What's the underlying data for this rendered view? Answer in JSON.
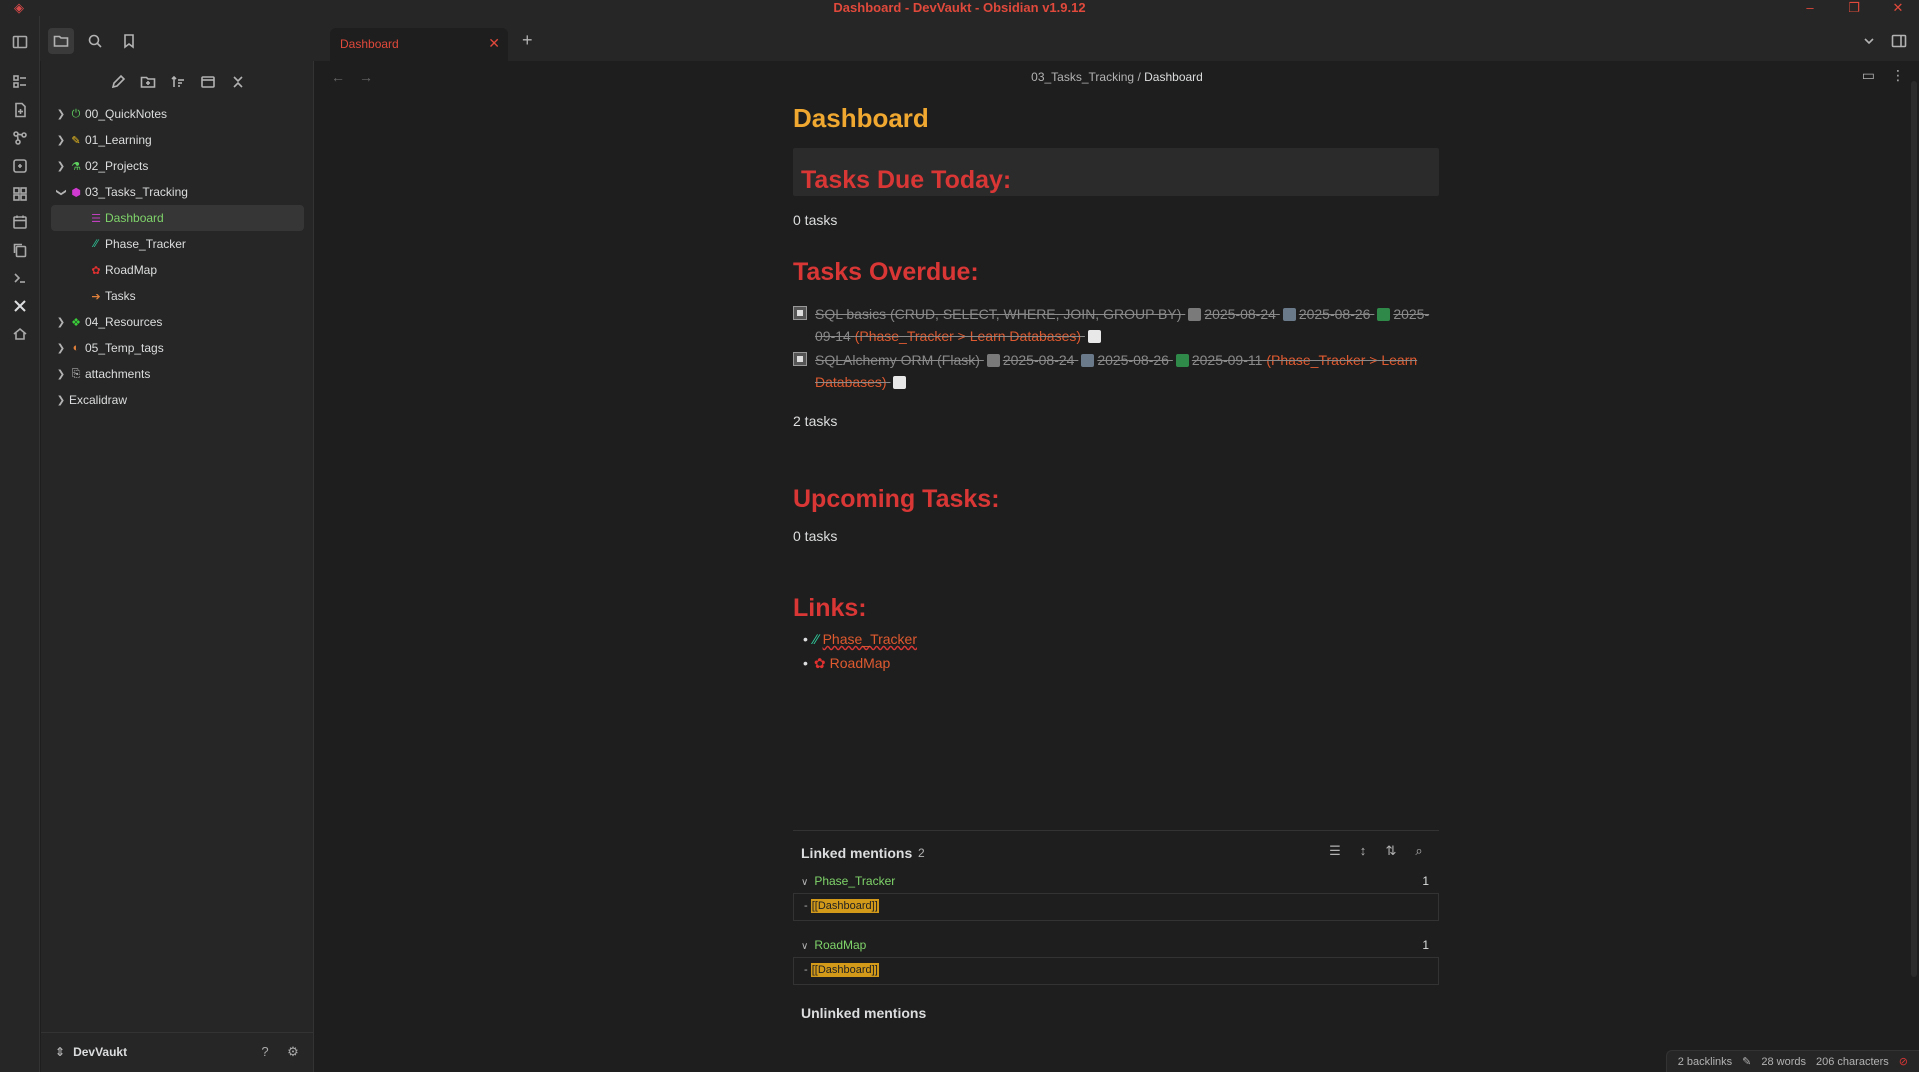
{
  "window": {
    "title": "Dashboard - DevVaukt - Obsidian v1.9.12",
    "controls": [
      "–",
      "❐",
      "✕"
    ]
  },
  "tab": {
    "title": "Dashboard",
    "close": "✕",
    "new": "+"
  },
  "breadcrumb": {
    "folder": "03_Tasks_Tracking",
    "sep": "/",
    "current": "Dashboard"
  },
  "sidebar": {
    "tree": [
      {
        "label": "00_QuickNotes",
        "type": "folder",
        "icon": "⏻",
        "icon_color": "#5fd35f"
      },
      {
        "label": "01_Learning",
        "type": "folder",
        "icon": "✎",
        "icon_color": "#f0c020"
      },
      {
        "label": "02_Projects",
        "type": "folder",
        "icon": "⚗",
        "icon_color": "#5fd35f"
      },
      {
        "label": "03_Tasks_Tracking",
        "type": "folder-open",
        "icon": "⬢",
        "icon_color": "#d03ad0"
      },
      {
        "label": "Dashboard",
        "type": "file",
        "icon": "☰",
        "icon_color": "#c040c0",
        "selected": true
      },
      {
        "label": "Phase_Tracker",
        "type": "file",
        "icon": "∕∕",
        "icon_color": "#2fcf9f"
      },
      {
        "label": "RoadMap",
        "type": "file",
        "icon": "✿",
        "icon_color": "#e03030"
      },
      {
        "label": "Tasks",
        "type": "file",
        "icon": "➔",
        "icon_color": "#e0803a"
      },
      {
        "label": "04_Resources",
        "type": "folder",
        "icon": "❖",
        "icon_color": "#3ad03a"
      },
      {
        "label": "05_Temp_tags",
        "type": "folder",
        "icon": "◐",
        "icon_color": "#e0803a"
      },
      {
        "label": "attachments",
        "type": "folder",
        "icon": "⎘",
        "icon_color": "#cccccc"
      },
      {
        "label": "Excalidraw",
        "type": "folder",
        "icon": "",
        "icon_color": "#cccccc"
      }
    ],
    "vault_name": "DevVaukt"
  },
  "note": {
    "title": "Dashboard",
    "sections": {
      "due_today": {
        "heading": "Tasks Due Today:",
        "count": "0 tasks"
      },
      "overdue": {
        "heading": "Tasks Overdue:",
        "count": "2 tasks",
        "tasks": [
          {
            "text": "SQL basics (CRUD, SELECT, WHERE, JOIN, GROUP BY)",
            "start": "2025-08-24",
            "scheduled": "2025-08-26",
            "done": "2025-",
            "done_wrap": "09-14",
            "link": "(Phase_Tracker > Learn Databases)"
          },
          {
            "text": "SQLAlchemy ORM (Flask)",
            "start": "2025-08-24",
            "scheduled": "2025-08-26",
            "done": "2025-09-11",
            "link_a": "(Phase_Tracker >",
            "link_b": "Learn Databases)"
          }
        ]
      },
      "upcoming": {
        "heading": "Upcoming Tasks:",
        "count": "0 tasks"
      },
      "links": {
        "heading": "Links:",
        "items": [
          "Phase_Tracker",
          "RoadMap"
        ]
      }
    }
  },
  "backlinks": {
    "title": "Linked mentions",
    "count": "2",
    "groups": [
      {
        "name": "Phase_Tracker",
        "count": "1",
        "dash": "-",
        "match": "[[Dashboard]]"
      },
      {
        "name": "RoadMap",
        "count": "1",
        "dash": "-",
        "match": "[[Dashboard]]"
      }
    ],
    "unlinked_title": "Unlinked mentions"
  },
  "status": {
    "backlinks": "2 backlinks",
    "words": "28 words",
    "chars": "206 characters"
  },
  "colors": {
    "accent_red": "#d93636",
    "title_orange": "#f0a830",
    "link_orange": "#e05a30",
    "selected_green": "#7fd46a"
  }
}
